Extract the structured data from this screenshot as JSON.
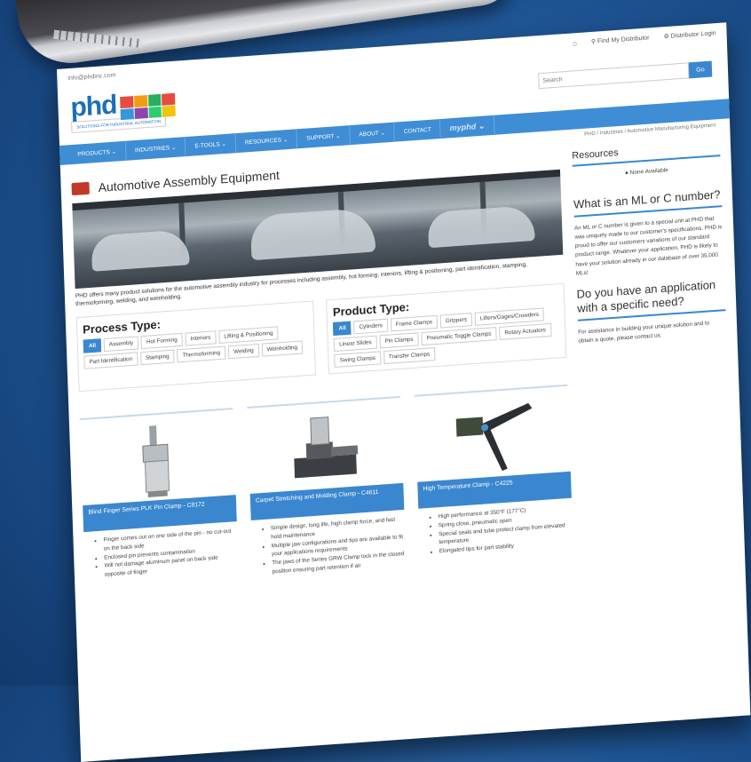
{
  "topbar": {
    "email": "info@phdinc.com",
    "find_distributor": "Find My Distributor",
    "distributor_login": "Distributor Login"
  },
  "logo": {
    "text": "phd",
    "tagline": "SOLUTIONS FOR INDUSTRIAL AUTOMATION"
  },
  "search": {
    "placeholder": "Search",
    "button": "Go"
  },
  "nav": {
    "items": [
      "PRODUCTS ⌄",
      "INDUSTRIES ⌄",
      "E-TOOLS ⌄",
      "RESOURCES ⌄",
      "SUPPORT ⌄",
      "ABOUT ⌄",
      "CONTACT"
    ],
    "brand": "myphd ⌄"
  },
  "breadcrumb": "PHD / Industries / Automotive Manufacturing Equipment",
  "page": {
    "title": "Automotive Assembly Equipment",
    "intro": "PHD offers many product solutions for the automotive assembly industry for processes including assembly, hot forming, interiors, lifting & positioning, part identification, stamping, thermoforming, welding, and weinholding."
  },
  "process": {
    "heading": "Process Type:",
    "tags": [
      "All",
      "Assembly",
      "Hot Forming",
      "Interiors",
      "Lifting & Positioning",
      "Part Identification",
      "Stamping",
      "Thermoforming",
      "Welding",
      "Weinholding"
    ]
  },
  "product_type": {
    "heading": "Product Type:",
    "tags": [
      "All",
      "Cylinders",
      "Frame Clamps",
      "Grippers",
      "Lifters/Gages/Crowders",
      "Linear Slides",
      "Pin Clamps",
      "Pneumatic Toggle Clamps",
      "Rotary Actuators",
      "Swing Clamps",
      "Transfer Clamps"
    ]
  },
  "products": [
    {
      "title": "Blind Finger Series PLK Pin Clamp - C8172",
      "bullets": [
        "Finger comes out on one side of the pin - no cut-out on the back side",
        "Enclosed pin prevents contamination",
        "Will not damage aluminum panel on back side opposite of finger"
      ]
    },
    {
      "title": "Carpet Stretching and Molding Clamp - C4611",
      "bullets": [
        "Simple design, long life, high clamp force, and fast hold maintenance",
        "Multiple jaw configurations and tips are available to fit your applications requirements",
        "The jaws of the Series GRW Clamp lock in the closed position ensuring part retention if air"
      ]
    },
    {
      "title": "High Temperature Clamp - C4225",
      "bullets": [
        "High performance at 350°F (177°C)",
        "Spring close, pneumatic open",
        "Special seals and tube protect clamp from elevated temperature",
        "Elongated tips for part stability"
      ]
    }
  ],
  "sidebar": {
    "resources_heading": "Resources",
    "resources_none": "None Available",
    "ml_heading": "What is an ML or C number?",
    "ml_text": "An ML or C number is given to a special unit at PHD that was uniquely made to our customer's specifications. PHD is proud to offer our customers variations of our standard product range. Whatever your application, PHD is likely to have your solution already in our database of over 35,000 MLs!",
    "app_heading": "Do you have an application with a specific need?",
    "app_text": "For assistance in building your unique solution and to obtain a quote, please contact us."
  },
  "colors": {
    "brand_blue": "#3a87cf",
    "nav_blue": "#3f8dd4",
    "background": "#1f5594"
  }
}
